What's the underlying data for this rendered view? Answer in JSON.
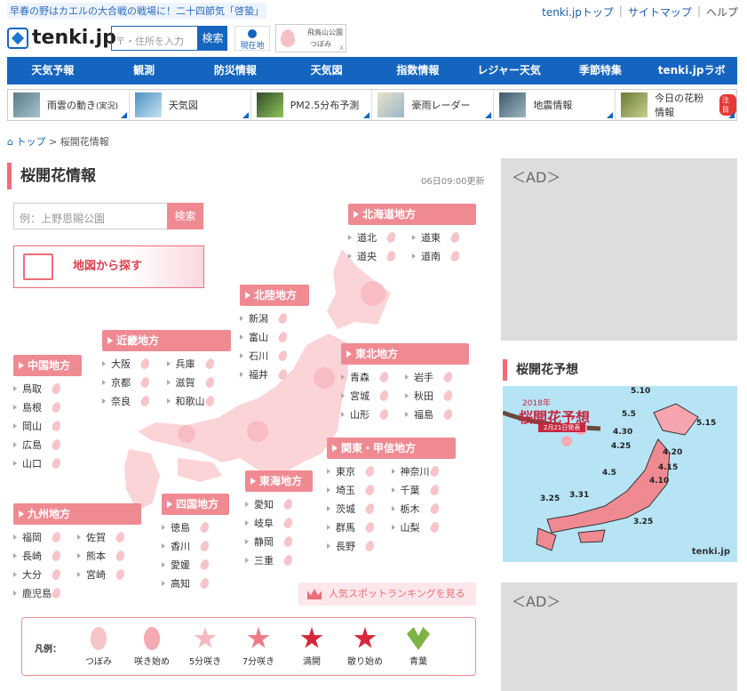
{
  "top_news": "早春の野はカエルの大合戦の戦場に！二十四節気「啓蟄」",
  "top_links": {
    "top": "tenki.jpトップ",
    "sitemap": "サイトマップ",
    "help": "ヘルプ"
  },
  "logo": "tenki.jp",
  "search": {
    "placeholder": "〒・住所を入力",
    "button": "検索"
  },
  "current_location": "現在地",
  "sakura_widget": {
    "name": "飛鳥山公園",
    "status": "つぼみ",
    "close": "x"
  },
  "main_nav": [
    "天気予報",
    "観測",
    "防災情報",
    "天気図",
    "指数情報",
    "レジャー天気",
    "季節特集",
    "tenki.jpラボ"
  ],
  "sub_nav": [
    {
      "label": "雨雲の動き",
      "suffix": "(実況)"
    },
    {
      "label": "天気図"
    },
    {
      "label": "PM2.5分布予測"
    },
    {
      "label": "豪雨レーダー"
    },
    {
      "label": "地震情報"
    },
    {
      "label": "今日の花粉情報",
      "badge": "注目"
    }
  ],
  "breadcrumb": {
    "home": "トップ",
    "sep": ">",
    "current": "桜開花情報"
  },
  "page_title": "桜開花情報",
  "updated": "06日09:00更新",
  "spot_search": {
    "placeholder": "例：上野恩賜公園",
    "button": "検索"
  },
  "map_search": "地図から探す",
  "regions": {
    "hokkaido": {
      "name": "北海道地方",
      "prefs": [
        "道北",
        "道東",
        "道央",
        "道南"
      ]
    },
    "hokuriku": {
      "name": "北陸地方",
      "prefs": [
        "新潟",
        "富山",
        "石川",
        "福井"
      ]
    },
    "kinki": {
      "name": "近畿地方",
      "prefs": [
        "大阪",
        "兵庫",
        "京都",
        "滋賀",
        "奈良",
        "和歌山"
      ]
    },
    "chugoku": {
      "name": "中国地方",
      "prefs": [
        "鳥取",
        "島根",
        "岡山",
        "広島",
        "山口"
      ]
    },
    "tohoku": {
      "name": "東北地方",
      "prefs": [
        "青森",
        "岩手",
        "宮城",
        "秋田",
        "山形",
        "福島"
      ]
    },
    "kanto": {
      "name": "関東・甲信地方",
      "prefs": [
        "東京",
        "神奈川",
        "埼玉",
        "千葉",
        "茨城",
        "栃木",
        "群馬",
        "山梨",
        "長野"
      ]
    },
    "tokai": {
      "name": "東海地方",
      "prefs": [
        "愛知",
        "岐阜",
        "静岡",
        "三重"
      ]
    },
    "shikoku": {
      "name": "四国地方",
      "prefs": [
        "徳島",
        "香川",
        "愛媛",
        "高知"
      ]
    },
    "kyushu": {
      "name": "九州地方",
      "prefs": [
        "福岡",
        "佐賀",
        "長崎",
        "熊本",
        "大分",
        "宮崎",
        "鹿児島"
      ]
    }
  },
  "ranking": "人気スポットランキングを見る",
  "legend": {
    "label": "凡例：",
    "stages": [
      {
        "label": "つぼみ",
        "color": "#f7c4c9"
      },
      {
        "label": "咲き始め",
        "color": "#f4aab2"
      },
      {
        "label": "5分咲き",
        "color": "#f6b8c0"
      },
      {
        "label": "7分咲き",
        "color": "#ef7b89"
      },
      {
        "label": "満開",
        "color": "#d8273a"
      },
      {
        "label": "散り始め",
        "color": "#d8273a"
      },
      {
        "label": "青葉",
        "color": "#7cb342"
      }
    ]
  },
  "ad_label": "＜AD＞",
  "forecast": {
    "title": "桜開花予想",
    "image_year": "2018年",
    "image_title": "桜開花予想",
    "image_date": "2月21日発表",
    "dates": [
      "5.10",
      "5.5",
      "5.15",
      "4.30",
      "4.25",
      "4.20",
      "4.15",
      "4.10",
      "4.5",
      "3.31",
      "3.25",
      "3.25"
    ],
    "logo": "tenki.jp"
  }
}
